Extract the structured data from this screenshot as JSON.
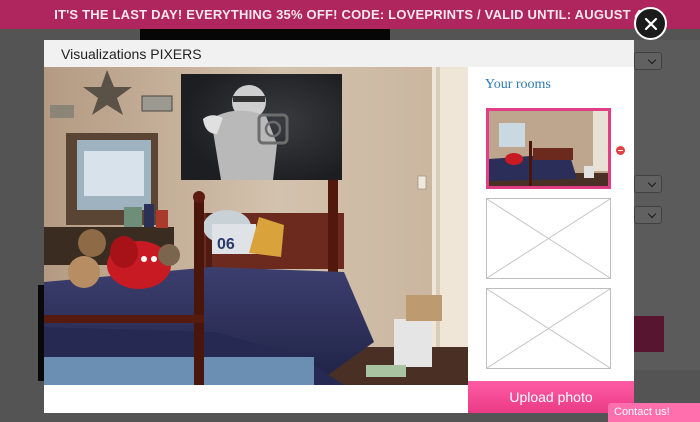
{
  "promo": {
    "text": "IT'S THE LAST DAY! EVERYTHING 35% OFF! CODE: LOVEPRINTS / VALID UNTIL: AUGUST 4."
  },
  "close": {
    "icon": "close-icon"
  },
  "modal": {
    "title": "Visualizations PIXERS",
    "preview": {
      "room": "bedroom-photo",
      "print": "football-player-photo"
    },
    "sidebar": {
      "title": "Your rooms",
      "thumbnails": [
        {
          "kind": "room-photo",
          "selected": true
        },
        {
          "kind": "empty-placeholder",
          "selected": false
        },
        {
          "kind": "empty-placeholder",
          "selected": false
        }
      ],
      "remove_icon": "remove-icon"
    },
    "upload_label": "Upload photo"
  },
  "contact": {
    "label": "Contact us!"
  },
  "colors": {
    "accent": "#e23e86",
    "link": "#2f79b5",
    "promo_bg": "#d62e73"
  }
}
